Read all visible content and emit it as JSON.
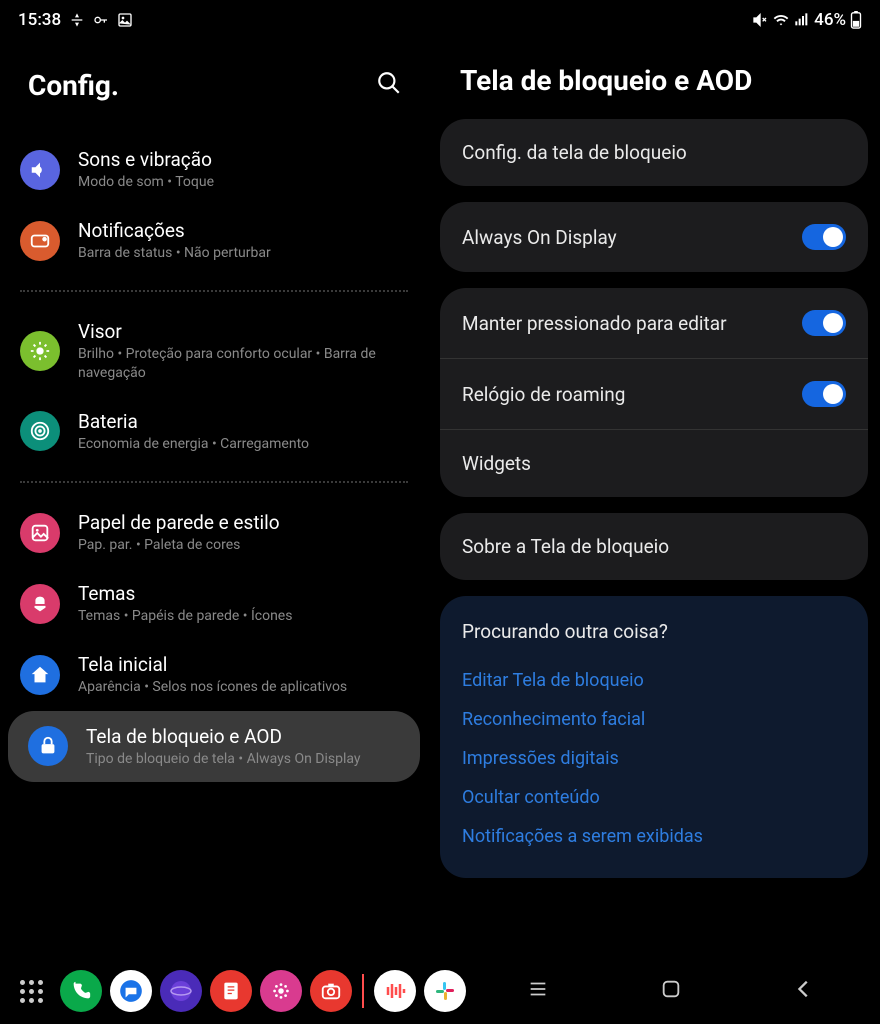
{
  "status": {
    "time": "15:38",
    "battery": "46%"
  },
  "left_pane": {
    "title": "Config.",
    "items": [
      {
        "title": "Sons e vibração",
        "subtitle": "Modo de som  •  Toque",
        "icon_bg": "#5965e0",
        "icon": "volume"
      },
      {
        "title": "Notificações",
        "subtitle": "Barra de status  •  Não perturbar",
        "icon_bg": "#d95b2e",
        "icon": "notif"
      },
      {
        "divider": true
      },
      {
        "title": "Visor",
        "subtitle": "Brilho  •  Proteção para conforto ocular  •  Barra de navegação",
        "icon_bg": "#7bbf2e",
        "icon": "brightness"
      },
      {
        "title": "Bateria",
        "subtitle": "Economia de energia  •  Carregamento",
        "icon_bg": "#0c8f7a",
        "icon": "battery"
      },
      {
        "divider": true
      },
      {
        "title": "Papel de parede e estilo",
        "subtitle": "Pap. par.  •  Paleta de cores",
        "icon_bg": "#d93b6b",
        "icon": "wallpaper"
      },
      {
        "title": "Temas",
        "subtitle": "Temas  •  Papéis de parede  •  Ícones",
        "icon_bg": "#d93b6b",
        "icon": "themes"
      },
      {
        "title": "Tela inicial",
        "subtitle": "Aparência  •  Selos nos ícones de aplicativos",
        "icon_bg": "#1f6fe0",
        "icon": "home"
      },
      {
        "title": "Tela de bloqueio e AOD",
        "subtitle": "Tipo de bloqueio de tela  •  Always On Display",
        "icon_bg": "#1f6fe0",
        "icon": "lock",
        "selected": true
      }
    ]
  },
  "right_pane": {
    "title": "Tela de bloqueio e AOD",
    "card1": [
      {
        "label": "Config. da tela de bloqueio"
      }
    ],
    "card2": [
      {
        "label": "Always On Display",
        "toggle": true
      }
    ],
    "card3": [
      {
        "label": "Manter pressionado para editar",
        "toggle": true
      },
      {
        "label": "Relógio de roaming",
        "toggle": true
      },
      {
        "label": "Widgets"
      }
    ],
    "card4": [
      {
        "label": "Sobre a Tela de bloqueio"
      }
    ],
    "related": {
      "title": "Procurando outra coisa?",
      "links": [
        "Editar Tela de bloqueio",
        "Reconhecimento facial",
        "Impressões digitais",
        "Ocultar conteúdo",
        "Notificações a serem exibidas"
      ]
    }
  },
  "dock": [
    {
      "name": "apps-grid",
      "bg": "transparent"
    },
    {
      "name": "phone",
      "bg": "#0aa94a"
    },
    {
      "name": "messages",
      "bg": "#fff"
    },
    {
      "name": "internet",
      "bg": "#4a2bb8"
    },
    {
      "name": "notes",
      "bg": "#e8382f"
    },
    {
      "name": "gallery",
      "bg": "#d93b8f"
    },
    {
      "name": "camera",
      "bg": "#e8382f"
    }
  ],
  "recent": [
    {
      "name": "podcast",
      "bg": "#fff"
    },
    {
      "name": "slack",
      "bg": "#fff"
    }
  ]
}
